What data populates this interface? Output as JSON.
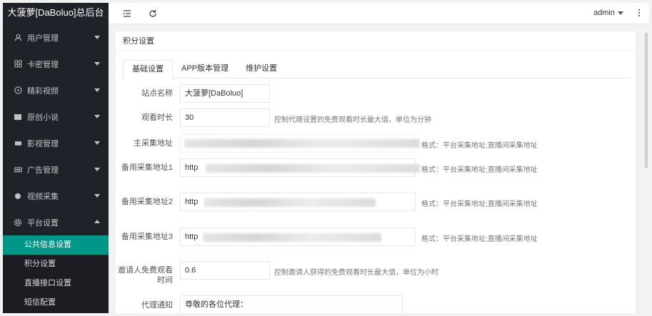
{
  "sidebar": {
    "title": "大菠萝[DaBoluo]总后台",
    "items": [
      {
        "label": "用户管理"
      },
      {
        "label": "卡密管理"
      },
      {
        "label": "精彩视频"
      },
      {
        "label": "原创小说"
      },
      {
        "label": "影视管理"
      },
      {
        "label": "广告管理"
      },
      {
        "label": "视频采集"
      },
      {
        "label": "平台设置"
      }
    ],
    "subitems": [
      {
        "label": "公共信息设置"
      },
      {
        "label": "积分设置"
      },
      {
        "label": "直播接口设置"
      },
      {
        "label": "短信配置"
      }
    ]
  },
  "header": {
    "user": "admin"
  },
  "card": {
    "title": "积分设置",
    "tabs": [
      {
        "label": "基础设置"
      },
      {
        "label": "APP版本管理"
      },
      {
        "label": "维护设置"
      }
    ]
  },
  "form": {
    "site_name_label": "站点名称",
    "site_name_value": "大菠萝[DaBoluo]",
    "watch_time_label": "观看时长",
    "watch_time_value": "30",
    "watch_time_hint": "控制代理设置的免费观看时长最大值，单位为分钟",
    "main_source_label": "主采集地址",
    "main_source_hint": "格式：平台采集地址;直播间采集地址",
    "backup1_label": "备用采集地址1",
    "backup1_value": "http",
    "backup1_hint": "格式：平台采集地址;直播间采集地址",
    "backup2_label": "备用采集地址2",
    "backup2_value": "http",
    "backup2_hint": "格式：平台采集地址;直播间采集地址",
    "backup3_label": "备用采集地址3",
    "backup3_value": "http",
    "backup3_hint": "格式：平台采集地址;直播间采集地址",
    "invite_label": "邀请人免费观看时间",
    "invite_value": "0.6",
    "invite_hint": "控制邀请人获得的免费观看时长最大值，单位为小时",
    "notice_label": "代理通知",
    "notice_value": "尊敬的各位代理："
  }
}
